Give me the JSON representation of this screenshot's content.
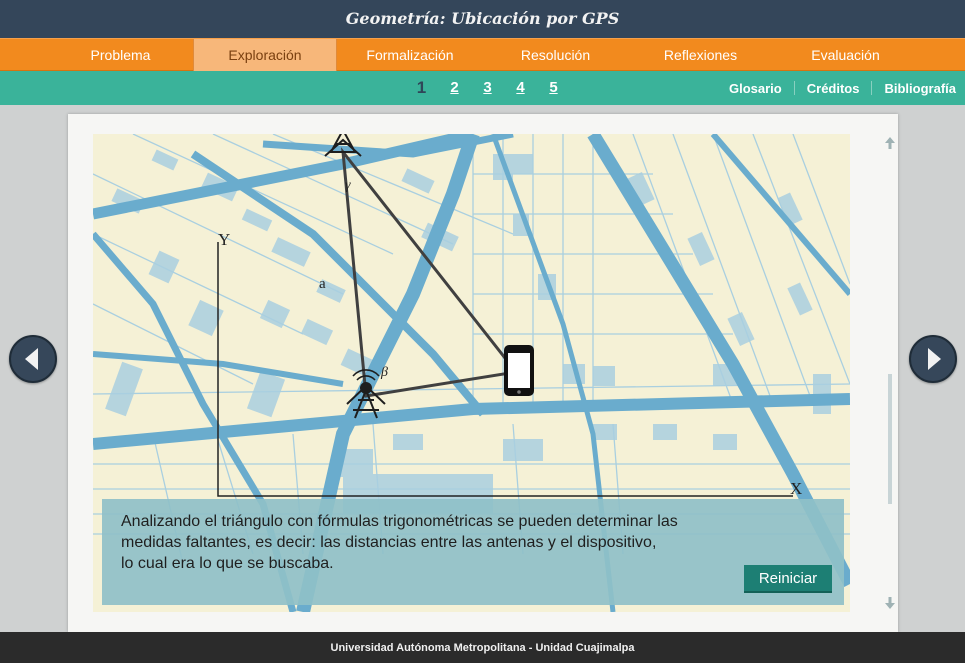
{
  "header": {
    "title": "Geometría: Ubicación por GPS"
  },
  "main_nav": {
    "tabs": [
      {
        "label": "Problema"
      },
      {
        "label": "Exploración",
        "active": true
      },
      {
        "label": "Formalización"
      },
      {
        "label": "Resolución"
      },
      {
        "label": "Reflexiones"
      },
      {
        "label": "Evaluación"
      }
    ]
  },
  "sub_nav": {
    "pages": [
      "1",
      "2",
      "3",
      "4",
      "5"
    ],
    "current_page": "1",
    "links": [
      "Glosario",
      "Créditos",
      "Bibliografía"
    ]
  },
  "figure": {
    "axis_y_label": "Y",
    "axis_x_label": "X",
    "side_label": "a",
    "angle_gamma": "γ",
    "angle_beta": "β"
  },
  "content": {
    "text_line1": "Analizando el triángulo con fórmulas trigonométricas se pueden determinar las",
    "text_line2": "medidas faltantes, es decir: las distancias entre las antenas y el dispositivo,",
    "text_line3": "lo cual era lo que se buscaba.",
    "reset_label": "Reiniciar"
  },
  "footer": {
    "text": "Universidad Autónoma Metropolitana - Unidad Cuajimalpa"
  },
  "colors": {
    "header_bg": "#34465a",
    "main_nav_bg": "#f28a1e",
    "sub_nav_bg": "#3ab39a",
    "map_bg": "#f5f1d6",
    "road_color": "#6aaccd",
    "textbox_bg": "#8fc0c8",
    "reset_button": "#1d7f74"
  },
  "icons": [
    "arrow-left-icon",
    "arrow-right-icon",
    "scroll-up-icon",
    "scroll-down-icon",
    "antenna-icon",
    "smartphone-icon"
  ]
}
